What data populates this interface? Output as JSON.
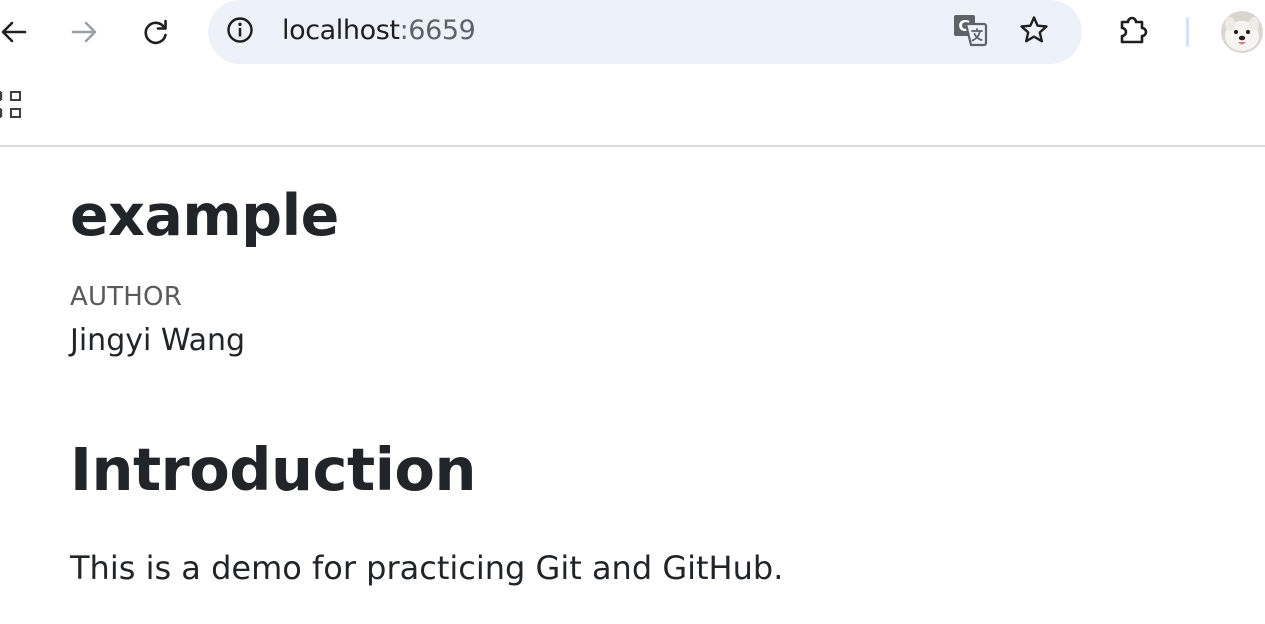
{
  "browser": {
    "url_host": "localhost",
    "url_port": ":6659",
    "back_icon": "arrow-left-icon",
    "forward_icon": "arrow-right-icon",
    "reload_icon": "reload-icon",
    "site_info_icon": "info-icon",
    "translate_icon": "translate-icon",
    "bookmark_icon": "star-icon",
    "extensions_icon": "puzzle-icon",
    "apps_icon": "apps-grid-icon",
    "omnibox_color": "#edf2fa",
    "divider_color": "#d3e3fd"
  },
  "page": {
    "title": "example",
    "author_label": "AUTHOR",
    "author_name": "Jingyi Wang",
    "sections": [
      {
        "heading": "Introduction",
        "body": "This is a demo for practicing Git and GitHub."
      }
    ]
  }
}
